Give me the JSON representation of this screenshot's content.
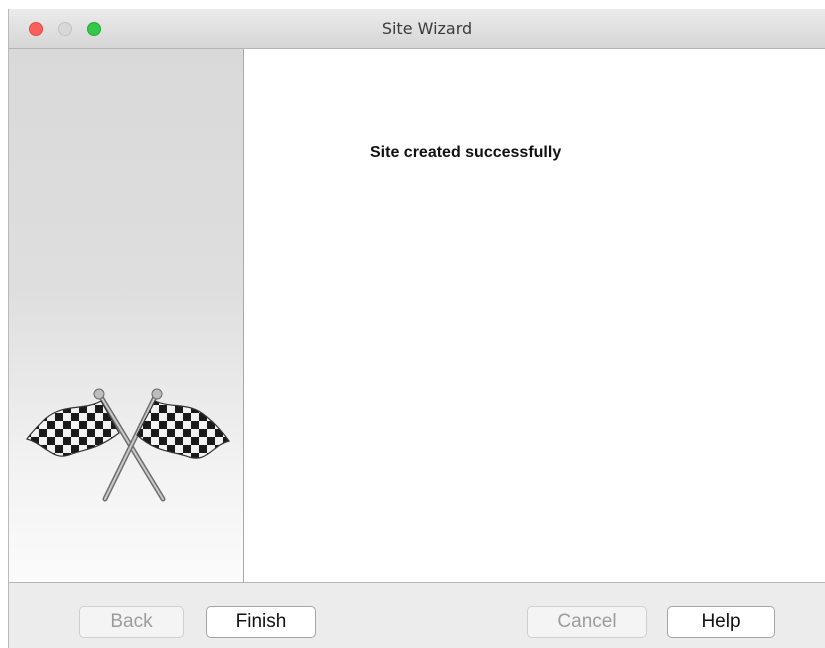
{
  "window": {
    "title": "Site Wizard"
  },
  "title_bar": {
    "buttons": [
      {
        "name": "close",
        "color": "#fc605c"
      },
      {
        "name": "minimize",
        "color": "#d8d8d8"
      },
      {
        "name": "zoom",
        "color": "#34c84a"
      }
    ]
  },
  "side_panel": {
    "icon": "checkered-flags-icon"
  },
  "content": {
    "message": "Site created successfully"
  },
  "buttons": {
    "back": {
      "label": "Back",
      "enabled": false
    },
    "finish": {
      "label": "Finish",
      "enabled": true
    },
    "cancel": {
      "label": "Cancel",
      "enabled": false
    },
    "help": {
      "label": "Help",
      "enabled": true
    }
  }
}
